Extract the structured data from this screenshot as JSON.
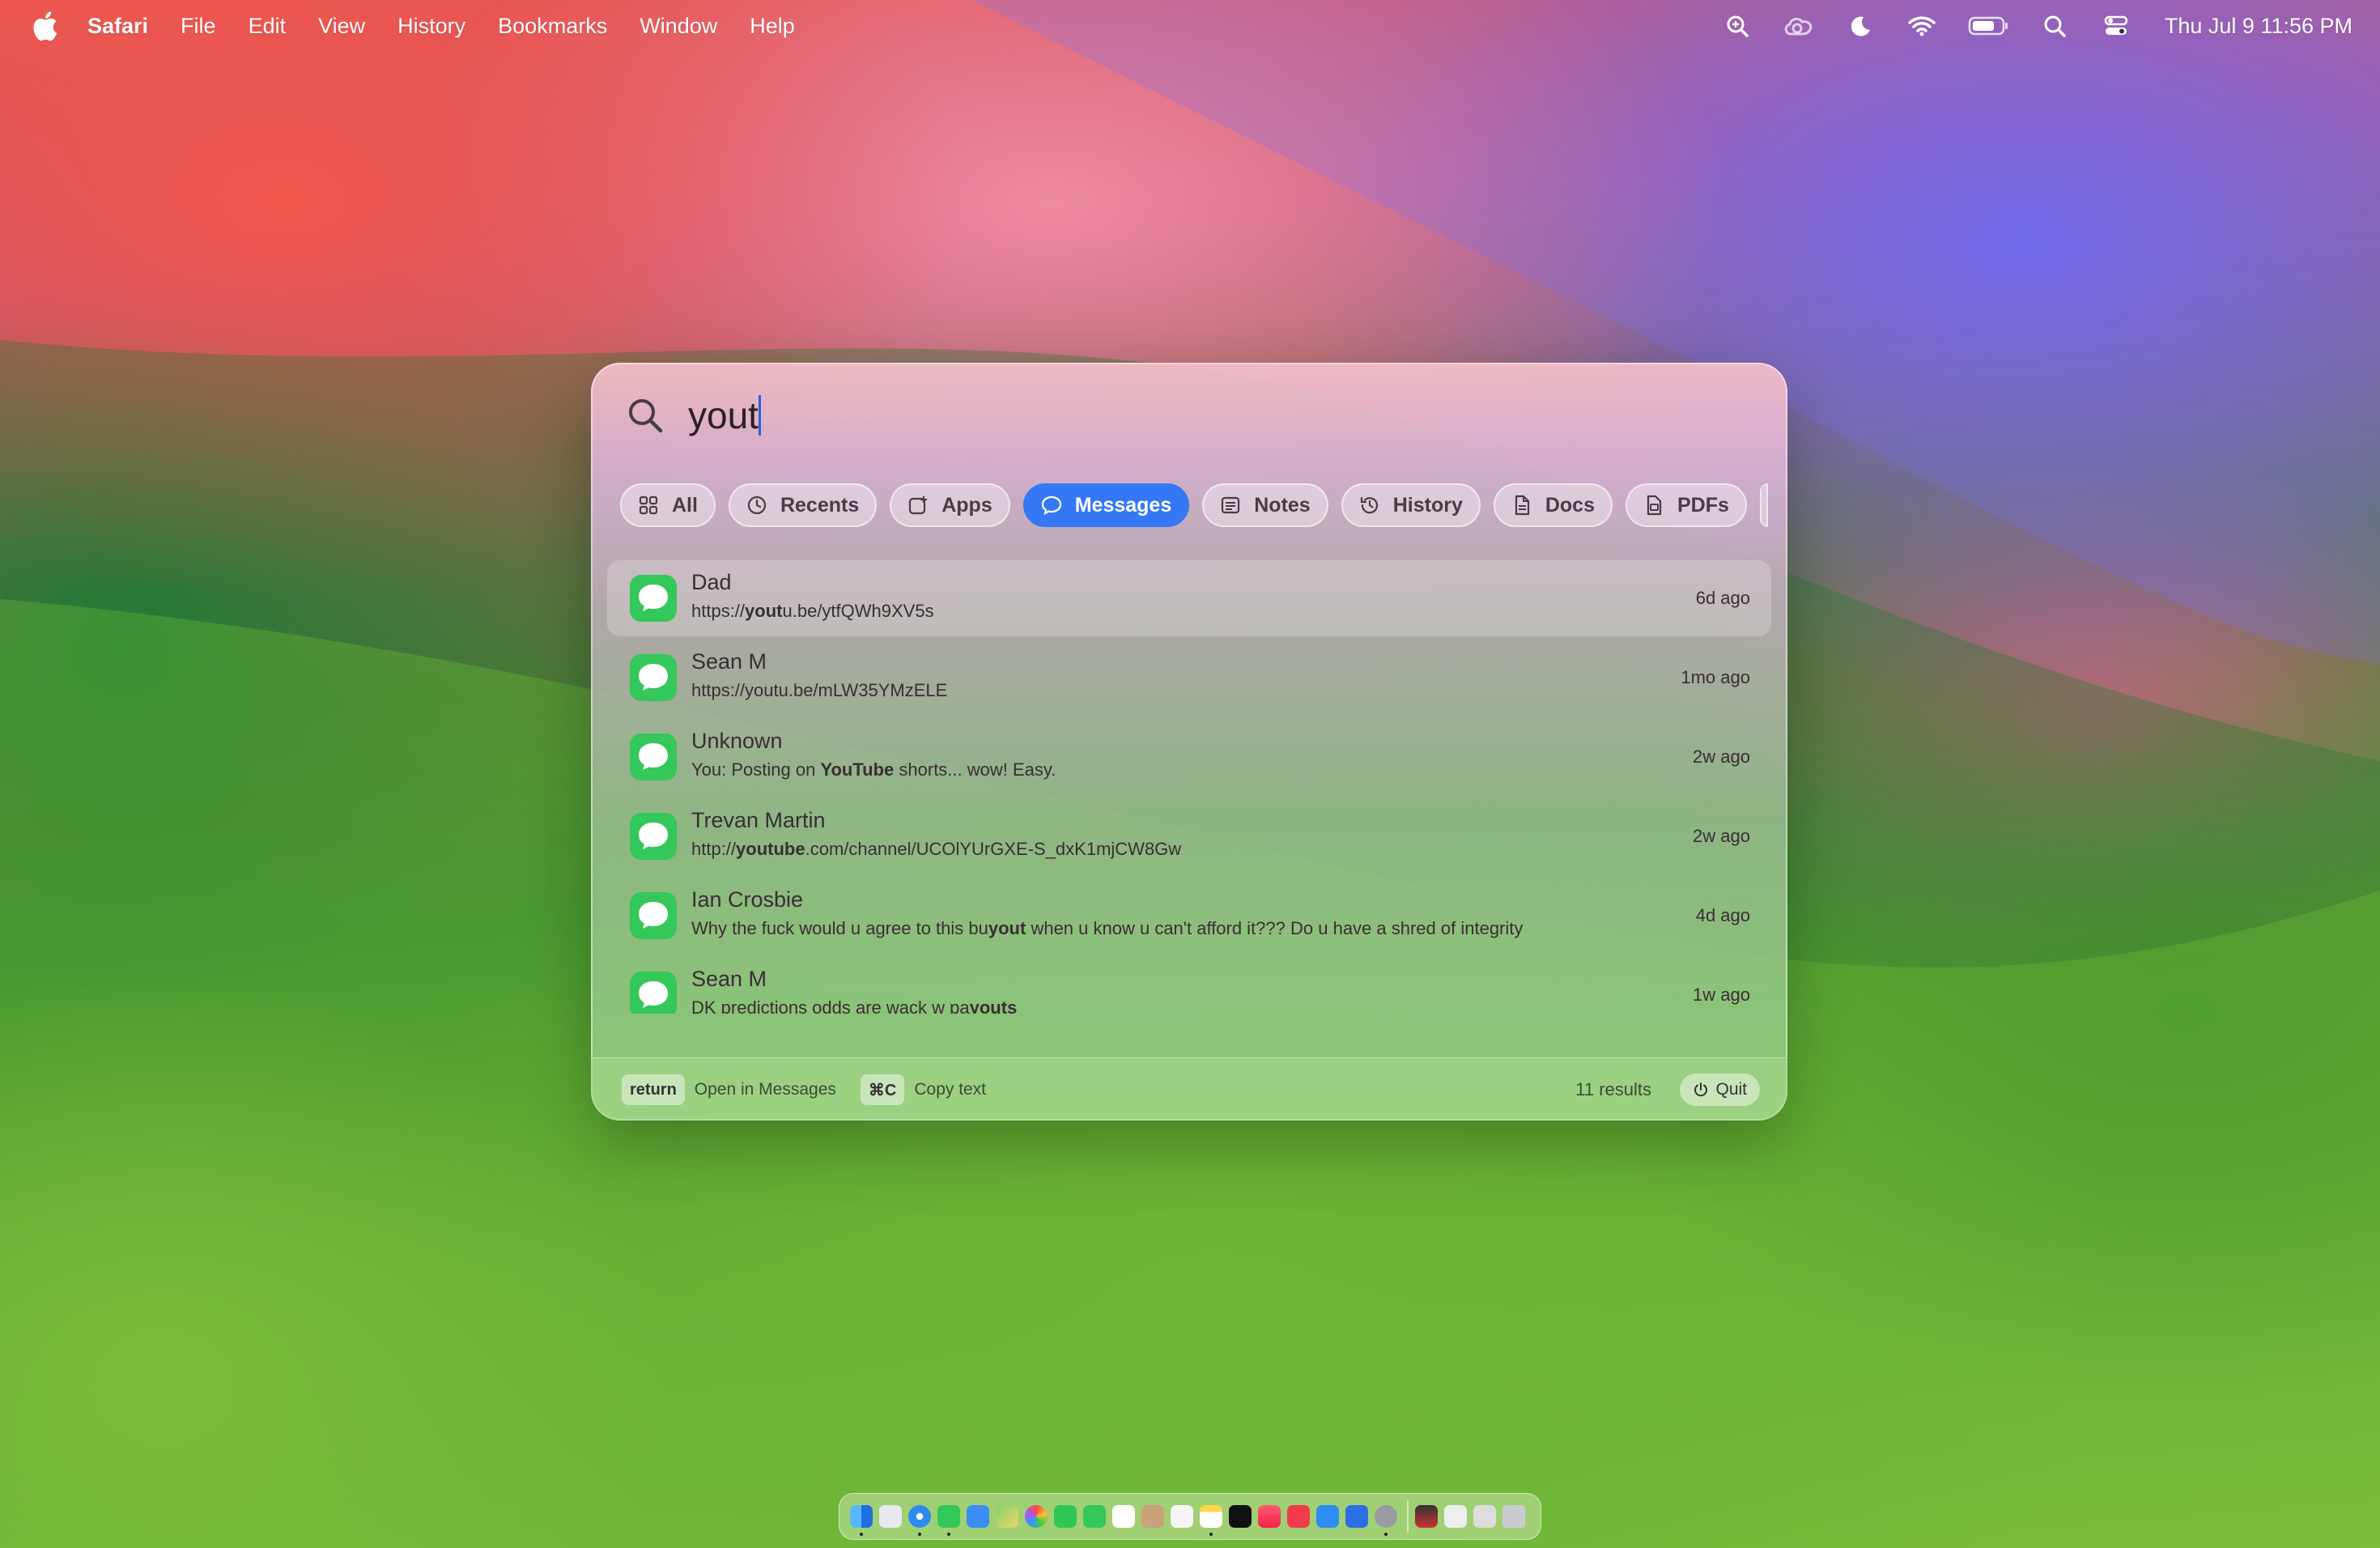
{
  "menubar": {
    "app_name": "Safari",
    "menus": [
      "File",
      "Edit",
      "View",
      "History",
      "Bookmarks",
      "Window",
      "Help"
    ],
    "status_icons": [
      "zoom-icon",
      "creative-cloud-icon",
      "focus-moon-icon",
      "wifi-icon",
      "battery-icon",
      "spotlight-icon",
      "control-center-icon"
    ],
    "clock": "Thu Jul 9  11:56 PM"
  },
  "spotlight": {
    "query": "yout",
    "filters": [
      {
        "label": "All",
        "icon": "grid-icon",
        "active": false
      },
      {
        "label": "Recents",
        "icon": "clock-icon",
        "active": false
      },
      {
        "label": "Apps",
        "icon": "apps-icon",
        "active": false
      },
      {
        "label": "Messages",
        "icon": "message-bubble-icon",
        "active": true
      },
      {
        "label": "Notes",
        "icon": "notes-icon",
        "active": false
      },
      {
        "label": "History",
        "icon": "history-icon",
        "active": false
      },
      {
        "label": "Docs",
        "icon": "document-icon",
        "active": false
      },
      {
        "label": "PDFs",
        "icon": "pdf-icon",
        "active": false
      }
    ],
    "results": [
      {
        "name": "Dad",
        "snippet_pre": "https://",
        "snippet_bold": "yout",
        "snippet_post": "u.be/ytfQWh9XV5s",
        "time": "6d ago",
        "selected": true
      },
      {
        "name": "Sean M",
        "snippet_pre": "https://youtu.be/mLW35YMzELE",
        "snippet_bold": "",
        "snippet_post": "",
        "time": "1mo ago",
        "selected": false
      },
      {
        "name": "Unknown",
        "snippet_pre": "You: Posting on ",
        "snippet_bold": "YouTube",
        "snippet_post": " shorts... wow! Easy.",
        "time": "2w ago",
        "selected": false
      },
      {
        "name": "Trevan Martin",
        "snippet_pre": "http://",
        "snippet_bold": "youtube",
        "snippet_post": ".com/channel/UCOlYUrGXE-S_dxK1mjCW8Gw",
        "time": "2w ago",
        "selected": false
      },
      {
        "name": "Ian Crosbie",
        "snippet_pre": "Why the fuck would u agree to this bu",
        "snippet_bold": "yout",
        "snippet_post": " when u know u can't afford it??? Do u have a shred of integrity",
        "time": "4d ago",
        "selected": false
      },
      {
        "name": "Sean M",
        "snippet_pre": "DK predictions odds are wack w pa",
        "snippet_bold": "youts",
        "snippet_post": "",
        "time": "1w ago",
        "selected": false
      }
    ],
    "footer": {
      "return_key": "return",
      "return_label": "Open in Messages",
      "copy_key": "⌘C",
      "copy_label": "Copy text",
      "count": "11 results",
      "quit_label": "Quit"
    }
  },
  "colors": {
    "accent": "#3478f6",
    "messages_green": "#34c759"
  }
}
